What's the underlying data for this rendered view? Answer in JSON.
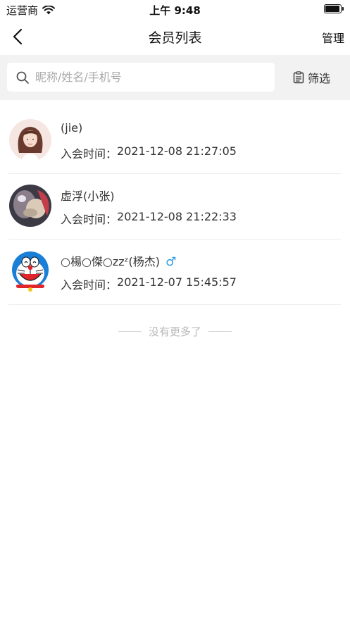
{
  "status_bar": {
    "carrier": "运营商",
    "time": "上午 9:48"
  },
  "nav": {
    "title": "会员列表",
    "manage_label": "管理"
  },
  "search": {
    "placeholder": "昵称/姓名/手机号",
    "value": "",
    "filter_label": "筛选"
  },
  "members": [
    {
      "name": "(jie)",
      "join_label": "入会时间：",
      "join_time": "2021-12-08 21:27:05",
      "gender": ""
    },
    {
      "name": "虚浮(小张)",
      "join_label": "入会时间：",
      "join_time": "2021-12-08 21:22:33",
      "gender": ""
    },
    {
      "name": "○楊○傑○zzᶻ(杨杰)",
      "join_label": "入会时间：",
      "join_time": "2021-12-07 15:45:57",
      "gender": "♂"
    }
  ],
  "end_note": "没有更多了",
  "colors": {
    "accent_gender": "#2f9be0",
    "search_bg": "#f2f2f2"
  }
}
